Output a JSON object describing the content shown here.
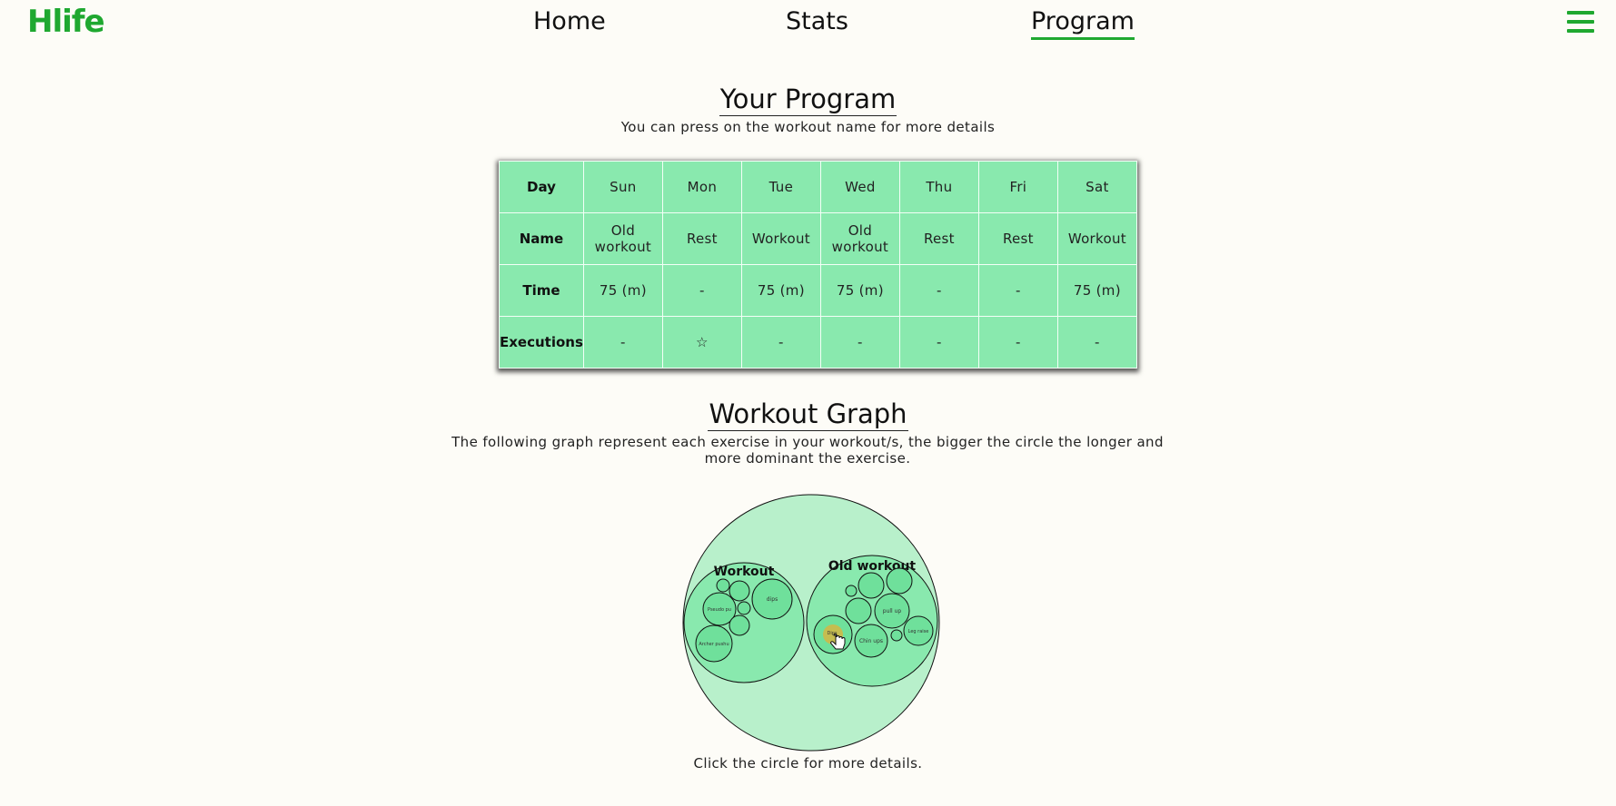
{
  "navbar": {
    "logo": "Hlife",
    "links": [
      {
        "label": "Home"
      },
      {
        "label": "Stats"
      },
      {
        "label": "Program",
        "active": true
      }
    ],
    "menu_icon": "hamburger-menu-icon",
    "accent_color": "#1fa830"
  },
  "program": {
    "title": "Your Program",
    "subtitle": "You can press on the workout name for more details",
    "table": {
      "row_headers": [
        "Day",
        "Name",
        "Time",
        "Executions"
      ],
      "days": [
        "Sun",
        "Mon",
        "Tue",
        "Wed",
        "Thu",
        "Fri",
        "Sat"
      ],
      "names": [
        "Old workout",
        "Rest",
        "Workout",
        "Old workout",
        "Rest",
        "Rest",
        "Workout"
      ],
      "times": [
        "75 (m)",
        "-",
        "75 (m)",
        "75 (m)",
        "-",
        "-",
        "75 (m)"
      ],
      "executions": [
        "-",
        "☆",
        "-",
        "-",
        "-",
        "-",
        "-"
      ],
      "executions_icon": "star-icon"
    },
    "table_color": "#89e9ae"
  },
  "graph": {
    "title": "Workout Graph",
    "description": "The following graph represent each exercise in your workout/s, the bigger the circle the longer and more dominant the exercise.",
    "footer": "Click the circle for more details.",
    "groups": [
      {
        "name": "Workout",
        "exercises": [
          "dips",
          "Pseudo pu",
          "Archer pushu"
        ]
      },
      {
        "name": "Old workout",
        "exercises": [
          "pull up",
          "Chin ups",
          "Dips",
          "Leg raise"
        ]
      }
    ],
    "colors": {
      "outer": "#b8f0cb",
      "group": "#89e9ae",
      "exercise": "#6fe09b",
      "selected": "#c5bd50"
    }
  }
}
